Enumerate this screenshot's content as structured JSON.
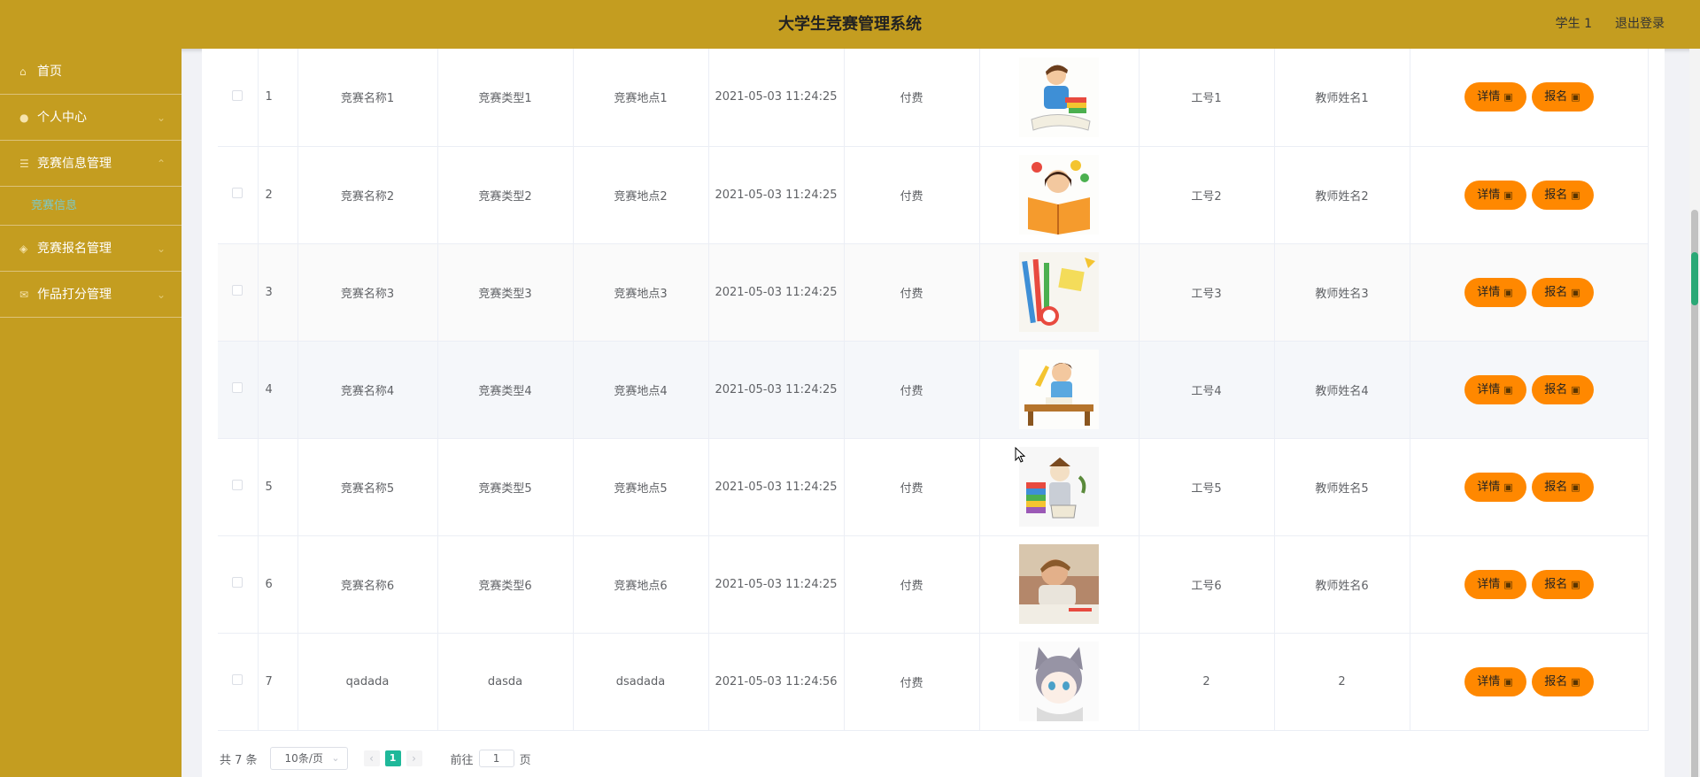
{
  "header": {
    "title": "大学生竞赛管理系统",
    "user": "学生 1",
    "logout": "退出登录"
  },
  "sidebar": {
    "items": [
      {
        "label": "首页",
        "icon": "home-icon"
      },
      {
        "label": "个人中心",
        "icon": "user-icon"
      },
      {
        "label": "竞赛信息管理",
        "icon": "list-icon"
      },
      {
        "label": "竞赛报名管理",
        "icon": "signup-icon"
      },
      {
        "label": "作品打分管理",
        "icon": "mail-icon"
      }
    ],
    "sub_item": "竞赛信息"
  },
  "table": {
    "rows": [
      {
        "index": "1",
        "name": "竞赛名称1",
        "type": "竞赛类型1",
        "location": "竞赛地点1",
        "time": "2021-05-03 11:24:25",
        "fee": "付费",
        "image": "boy-reading-illustration",
        "job_no": "工号1",
        "teacher": "教师姓名1"
      },
      {
        "index": "2",
        "name": "竞赛名称2",
        "type": "竞赛类型2",
        "location": "竞赛地点2",
        "time": "2021-05-03 11:24:25",
        "fee": "付费",
        "image": "girl-book-illustration",
        "job_no": "工号2",
        "teacher": "教师姓名2"
      },
      {
        "index": "3",
        "name": "竞赛名称3",
        "type": "竞赛类型3",
        "location": "竞赛地点3",
        "time": "2021-05-03 11:24:25",
        "fee": "付费",
        "image": "school-supplies-illustration",
        "job_no": "工号3",
        "teacher": "教师姓名3"
      },
      {
        "index": "4",
        "name": "竞赛名称4",
        "type": "竞赛类型4",
        "location": "竞赛地点4",
        "time": "2021-05-03 11:24:25",
        "fee": "付费",
        "image": "student-desk-illustration",
        "job_no": "工号4",
        "teacher": "教师姓名4"
      },
      {
        "index": "5",
        "name": "竞赛名称5",
        "type": "竞赛类型5",
        "location": "竞赛地点5",
        "time": "2021-05-03 11:24:25",
        "fee": "付费",
        "image": "scholar-books-illustration",
        "job_no": "工号5",
        "teacher": "教师姓名5"
      },
      {
        "index": "6",
        "name": "竞赛名称6",
        "type": "竞赛类型6",
        "location": "竞赛地点6",
        "time": "2021-05-03 11:24:25",
        "fee": "付费",
        "image": "child-studying-photo",
        "job_no": "工号6",
        "teacher": "教师姓名6"
      },
      {
        "index": "7",
        "name": "qadada",
        "type": "dasda",
        "location": "dsadada",
        "time": "2021-05-03 11:24:56",
        "fee": "付费",
        "image": "anime-catboy-illustration",
        "job_no": "2",
        "teacher": "2"
      }
    ],
    "detail_label": "详情",
    "signup_label": "报名"
  },
  "pagination": {
    "total": "共 7 条",
    "page_size": "10条/页",
    "current_page": "1",
    "goto_label": "前往",
    "goto_value": "1",
    "page_suffix": "页"
  },
  "colors": {
    "brand": "#c49d20",
    "button": "#ff8800",
    "active_page": "#1fb89a",
    "submenu_active": "#7cc9c9"
  }
}
